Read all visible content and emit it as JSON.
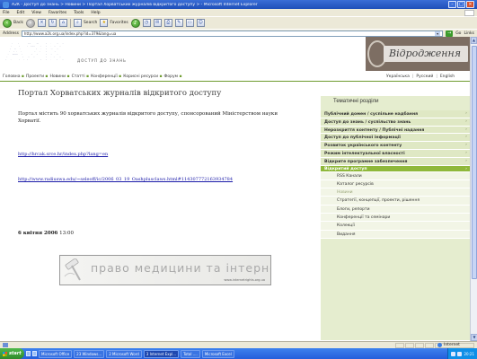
{
  "window": {
    "title": "A2K - Доступ до знань > Новини > Портал Хорватських журналів відкритого доступу > - Microsoft Internet Explorer",
    "menu": [
      "File",
      "Edit",
      "View",
      "Favorites",
      "Tools",
      "Help"
    ],
    "toolbar": {
      "back": "Back",
      "search": "Search",
      "favorites": "Favorites"
    },
    "address_label": "Address",
    "address_url": "http://www.a2k.org.ua/index.php?id=379&lang=ua",
    "go_label": "Go",
    "links_label": "Links"
  },
  "site": {
    "logo_text": "A2K",
    "logo_subtitle": "ДОСТУП ДО ЗНАНЬ",
    "brand_text": "Відродження",
    "lang_links": [
      "Українська",
      "Русский",
      "English"
    ],
    "nav": [
      "Головна",
      "Проекти",
      "Новини",
      "Статті",
      "Конференції",
      "Корисні ресурси",
      "Форум"
    ]
  },
  "article": {
    "title": "Портал Хорватських журналів відкритого доступу",
    "description": "Портал містить 90 хорватських журналів відкритого доступу, спонсорований Міністерством науки Хорватії.",
    "link1": "http://hrcak.srce.hr/index.php?lang=en",
    "link2": "http://www.radiuswa.edu/~seleoff/ic/2006_03_19_Oashplusclaws.html#114307772163934784",
    "date_bold": "6 квітня 2006",
    "date_time": "13:00",
    "banner_text": "право медицини та інтернет",
    "banner_url": "www.internetrights.org.ua"
  },
  "sidebar": {
    "title": "Тематичні розділи",
    "items": [
      "Публічний домен / суспільне надбання",
      "Доступ до знань / суспільство знань",
      "Нерозкриття контенту / Публічні надання",
      "Доступ до публічної інформації",
      "Розвиток українського контенту",
      "Режим інтелектуальної власності",
      "Відкрите програмне забезпечення"
    ],
    "active_item": "Відкритий доступ",
    "subitems": [
      "RSS Канали",
      "Каталог ресурсів",
      "Новини",
      "Стратегії, концепції, проекти, рішення",
      "Блоги, репорти",
      "Конференції та семінари",
      "Колекції",
      "Видання"
    ],
    "current_subitem": "Новини"
  },
  "statusbar": {
    "zone": "Internet"
  },
  "taskbar": {
    "start": "start",
    "tasks": [
      "Microsoft Office",
      "23 Windows...",
      "2 Microsoft Word",
      "3 Internet Expl...",
      "Total ....",
      "Microsoft Excel"
    ],
    "clock": "20:21"
  }
}
